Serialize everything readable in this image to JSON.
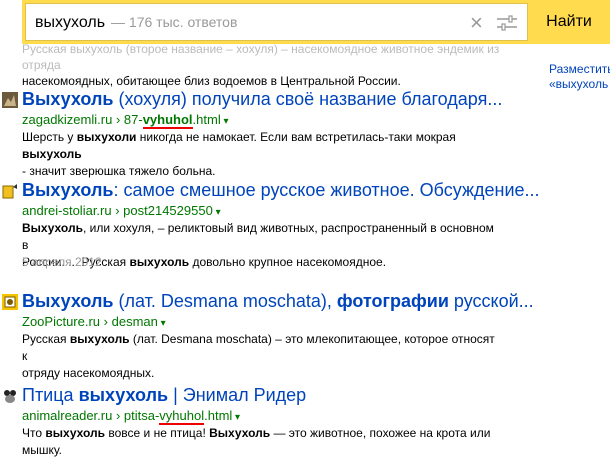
{
  "search": {
    "query": "выхухоль",
    "count": "— 176 тыс. ответов",
    "button_label": "Найти",
    "clear_icon": "close-icon",
    "filter_icon": "sliders-icon"
  },
  "top_snippet": {
    "line1": "Русская выхухоль (второе название – хохуля) – насекомоядное животное эндемик из отряда",
    "line2": "насекомоядных, обитающее близ водоемов в Центральной России."
  },
  "right_ad": {
    "line1": "Разместить",
    "line2": "«выхухоль"
  },
  "results": [
    {
      "title_bold": "Выхухоль",
      "title_rest": " (хохуля) получила своё название благодаря...",
      "url_domain": "zagadkizemli.ru",
      "url_sep": " › ",
      "url_pre": "87-",
      "url_bold": "vyhuhol",
      "url_post": ".html",
      "snippet_1": "Шерсть у ",
      "snippet_2": "выхухоли",
      "snippet_3": " никогда не намокает. Если вам встретилась-таки мокрая ",
      "snippet_4": "выхухоль",
      "snippet_5": "- значит зверюшка тяжело больна.",
      "favicon_icon": "zagadkizemli-favicon-icon"
    },
    {
      "title_bold": "Выхухоль",
      "title_rest": ": самое смешное русское животное. Обсуждение...",
      "url_domain": "andrei-stoliar.ru",
      "url_sep": " › ",
      "url_path": "post214529550",
      "snippet_1": "Выхухоль",
      "snippet_2": ", или хохуля, – реликтовый вид животных, распространенный в основном в",
      "snippet_3": "России. ... Русская ",
      "snippet_4": "выхухоль",
      "snippet_5": " довольно крупное насекомоядное.",
      "date": "5 апреля 2012",
      "favicon_icon": "andrei-stoliar-favicon-icon"
    },
    {
      "title_bold": "Выхухоль",
      "title_mid": " (лат. Desmana moschata), ",
      "title_bold2": "фотографии",
      "title_rest": " русской...",
      "url_domain": "ZooPicture.ru",
      "url_sep": " › ",
      "url_path": "desman",
      "snippet_1": "Русская ",
      "snippet_2": "выхухоль",
      "snippet_3": " (лат. Desmana moschata) – это млекопитающее, которое относят к",
      "snippet_4": "отряду насекомоядных.",
      "favicon_icon": "zoopicture-favicon-icon"
    },
    {
      "title_pre": "Птица ",
      "title_bold": "выхухоль",
      "title_rest": " | Энимал Ридер",
      "url_domain": "animalreader.ru",
      "url_sep": " › ",
      "url_pre": "ptitsa-",
      "url_red": "vyhuhol",
      "url_post": ".html",
      "snippet_1": "Что ",
      "snippet_2": "выхухоль",
      "snippet_3": " вовсе и не птица! ",
      "snippet_4": "Выхухоль",
      "snippet_5": " — это животное, похожее на крота или",
      "snippet_6": "мышку.",
      "favicon_icon": "animalreader-favicon-icon"
    }
  ],
  "colors": {
    "accent": "#ffdb4d",
    "link": "#0044bb",
    "url": "#007700",
    "underline": "#ee0000"
  }
}
